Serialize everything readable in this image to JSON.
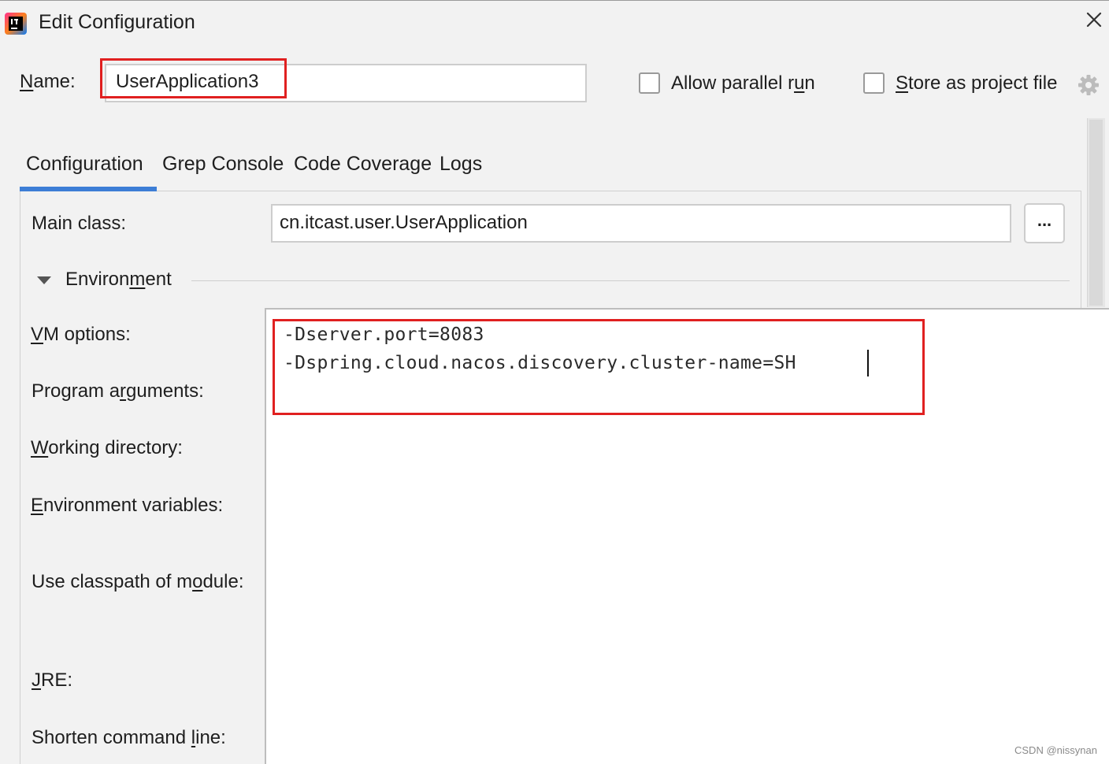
{
  "window": {
    "title": "Edit Configuration"
  },
  "name_row": {
    "label_pre": "",
    "label_mn": "N",
    "label_post": "ame:",
    "value": "UserApplication3"
  },
  "options": {
    "parallel": {
      "pre": "Allow parallel r",
      "mn": "u",
      "post": "n",
      "checked": false
    },
    "store": {
      "pre": "",
      "mn": "S",
      "post": "tore as project file",
      "checked": false
    }
  },
  "tabs": [
    {
      "label": "Configuration",
      "active": true
    },
    {
      "label": "Grep Console",
      "active": false
    },
    {
      "label": "Code Coverage",
      "active": false
    },
    {
      "label": "Logs",
      "active": false
    }
  ],
  "main_class": {
    "label": "Main class:",
    "value": "cn.itcast.user.UserApplication",
    "browse": "..."
  },
  "environment": {
    "pre": "Environ",
    "mn": "m",
    "post": "ent"
  },
  "fields": {
    "vm": {
      "pre": "",
      "mn": "V",
      "post": "M options:"
    },
    "prog": {
      "pre": "Program a",
      "mn": "r",
      "post": "guments:"
    },
    "work": {
      "pre": "",
      "mn": "W",
      "post": "orking directory:"
    },
    "envvars": {
      "pre": "",
      "mn": "E",
      "post": "nvironment variables:"
    },
    "classpath": {
      "pre": "Use classpath of m",
      "mn": "o",
      "post": "dule:"
    },
    "jre": {
      "pre": "",
      "mn": "J",
      "post": "RE:"
    },
    "shorten": {
      "pre": "Shorten command ",
      "mn": "l",
      "post": "ine:"
    }
  },
  "vm_options": {
    "line1": "-Dserver.port=8083",
    "line2": "-Dspring.cloud.nacos.discovery.cluster-name=SH"
  },
  "watermark": "CSDN @nissynan",
  "colors": {
    "accent": "#3d7ed6",
    "highlight": "#e02020"
  }
}
